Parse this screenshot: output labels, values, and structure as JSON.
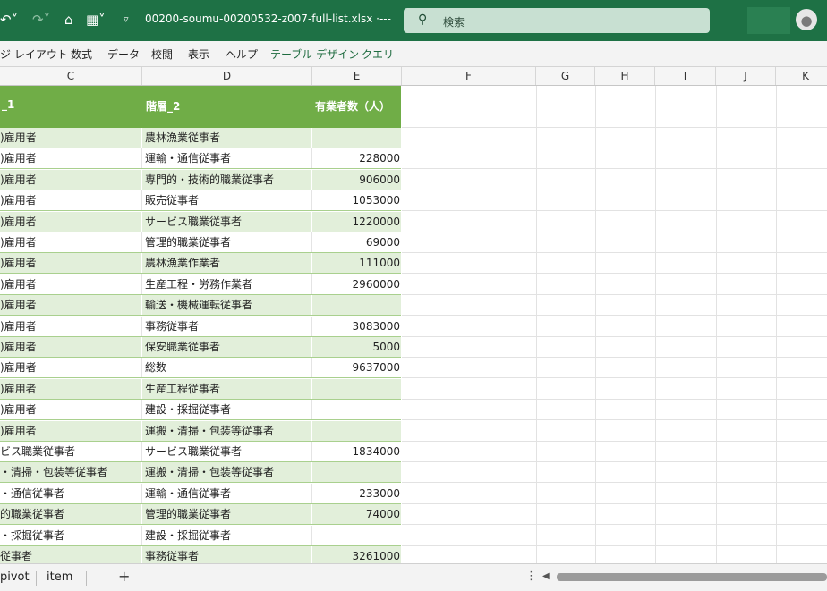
{
  "titlebar": {
    "filename": "00200-soumu-00200532-z007-full-list.xlsx  ·---",
    "search_placeholder": "検索",
    "undo_icon": "undo-icon",
    "redo_icon": "redo-icon",
    "open_icon": "folder-open-icon",
    "format_icon": "format-icon",
    "customize_icon": "customize-icon",
    "search_icon": "search-icon",
    "account_icon": "person-icon"
  },
  "ribbon": {
    "tabs": [
      "ジ レイアウト",
      "数式",
      "データ",
      "校閲",
      "表示",
      "ヘルプ",
      "テーブル デザイン",
      "クエリ"
    ]
  },
  "columns": [
    "C",
    "D",
    "E",
    "F",
    "G",
    "H",
    "I",
    "J",
    "K"
  ],
  "table": {
    "headers": {
      "c": "_1",
      "d": "階層_2",
      "e": "有業者数（人）"
    },
    "rows": [
      {
        "c": ")雇用者",
        "d": "農林漁業従事者",
        "e": ""
      },
      {
        "c": ")雇用者",
        "d": "運輸・通信従事者",
        "e": "228000"
      },
      {
        "c": ")雇用者",
        "d": "専門的・技術的職業従事者",
        "e": "906000"
      },
      {
        "c": ")雇用者",
        "d": "販売従事者",
        "e": "1053000"
      },
      {
        "c": ")雇用者",
        "d": "サービス職業従事者",
        "e": "1220000"
      },
      {
        "c": ")雇用者",
        "d": "管理的職業従事者",
        "e": "69000"
      },
      {
        "c": ")雇用者",
        "d": "農林漁業作業者",
        "e": "111000"
      },
      {
        "c": ")雇用者",
        "d": "生産工程・労務作業者",
        "e": "2960000"
      },
      {
        "c": ")雇用者",
        "d": "輸送・機械運転従事者",
        "e": ""
      },
      {
        "c": ")雇用者",
        "d": "事務従事者",
        "e": "3083000"
      },
      {
        "c": ")雇用者",
        "d": "保安職業従事者",
        "e": "5000"
      },
      {
        "c": ")雇用者",
        "d": "総数",
        "e": "9637000"
      },
      {
        "c": ")雇用者",
        "d": "生産工程従事者",
        "e": ""
      },
      {
        "c": ")雇用者",
        "d": "建設・採掘従事者",
        "e": ""
      },
      {
        "c": ")雇用者",
        "d": "運搬・清掃・包装等従事者",
        "e": ""
      },
      {
        "c": "ビス職業従事者",
        "d": "サービス職業従事者",
        "e": "1834000"
      },
      {
        "c": "・清掃・包装等従事者",
        "d": "運搬・清掃・包装等従事者",
        "e": ""
      },
      {
        "c": "・通信従事者",
        "d": "運輸・通信従事者",
        "e": "233000"
      },
      {
        "c": "的職業従事者",
        "d": "管理的職業従事者",
        "e": "74000"
      },
      {
        "c": "・採掘従事者",
        "d": "建設・採掘従事者",
        "e": ""
      },
      {
        "c": "従事者",
        "d": "事務従事者",
        "e": "3261000"
      }
    ]
  },
  "sheets": {
    "tabs": [
      "pivot",
      "item"
    ],
    "add_label": "+"
  },
  "colors": {
    "titlebar": "#1e7145",
    "table_header": "#70ad47",
    "band": "#e2efda"
  }
}
